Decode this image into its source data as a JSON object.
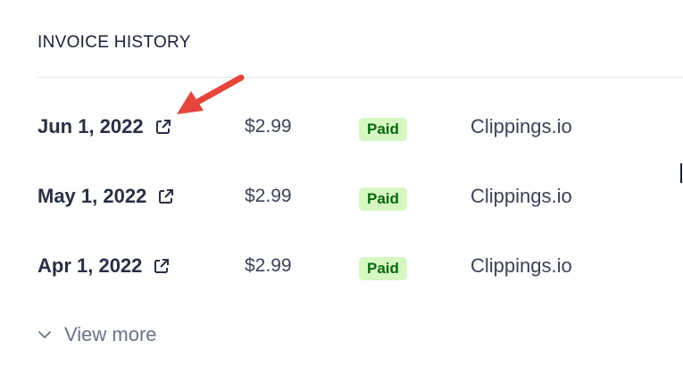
{
  "section": {
    "title": "INVOICE HISTORY"
  },
  "invoices": [
    {
      "date": "Jun 1, 2022",
      "amount": "$2.99",
      "status": "Paid",
      "merchant": "Clippings.io"
    },
    {
      "date": "May 1, 2022",
      "amount": "$2.99",
      "status": "Paid",
      "merchant": "Clippings.io"
    },
    {
      "date": "Apr 1, 2022",
      "amount": "$2.99",
      "status": "Paid",
      "merchant": "Clippings.io"
    }
  ],
  "footer": {
    "view_more_label": "View more",
    "view_more_icon": "chevron-down-icon"
  },
  "icons": {
    "invoice_link": "external-link-icon",
    "annotation": "red-arrow-icon"
  },
  "colors": {
    "paid_badge_bg": "#d7f7c2",
    "paid_badge_text": "#05690d",
    "annotation_arrow": "#e5453b"
  }
}
